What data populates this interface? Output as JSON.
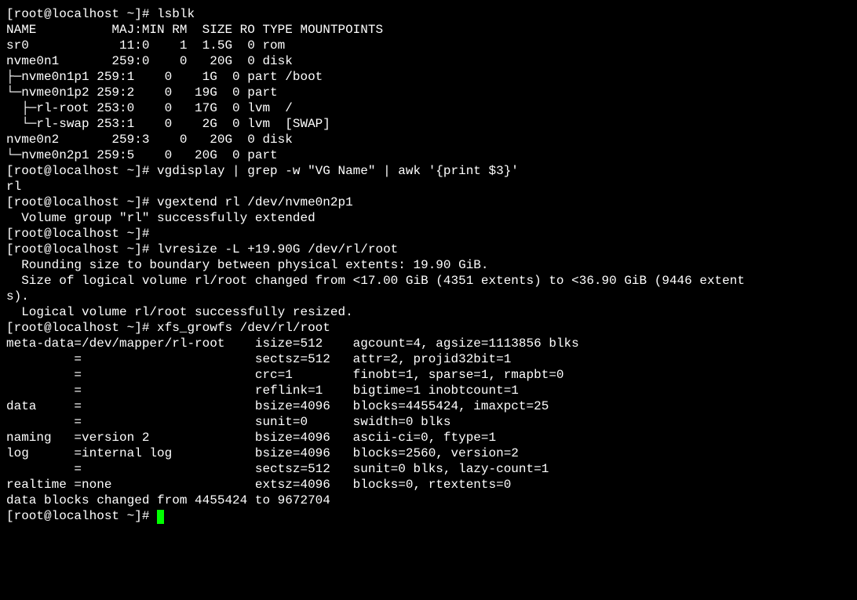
{
  "prompt": "[root@localhost ~]# ",
  "cmd1": "lsblk",
  "lsblk_header": "NAME          MAJ:MIN RM  SIZE RO TYPE MOUNTPOINTS",
  "lsblk_rows": [
    "sr0            11:0    1  1.5G  0 rom",
    "nvme0n1       259:0    0   20G  0 disk",
    "├─nvme0n1p1 259:1    0    1G  0 part /boot",
    "└─nvme0n1p2 259:2    0   19G  0 part",
    "  ├─rl-root 253:0    0   17G  0 lvm  /",
    "  └─rl-swap 253:1    0    2G  0 lvm  [SWAP]",
    "nvme0n2       259:3    0   20G  0 disk",
    "└─nvme0n2p1 259:5    0   20G  0 part"
  ],
  "cmd2": "vgdisplay | grep -w \"VG Name\" | awk '{print $3}'",
  "out2": "rl",
  "cmd3": "vgextend rl /dev/nvme0n2p1",
  "out3": "  Volume group \"rl\" successfully extended",
  "cmd4": "",
  "cmd5": "lvresize -L +19.90G /dev/rl/root",
  "out5a": "  Rounding size to boundary between physical extents: 19.90 GiB.",
  "out5b": "  Size of logical volume rl/root changed from <17.00 GiB (4351 extents) to <36.90 GiB (9446 extent",
  "out5c": "s).",
  "out5d": "  Logical volume rl/root successfully resized.",
  "cmd6": "xfs_growfs /dev/rl/root",
  "xfs_rows": [
    "meta-data=/dev/mapper/rl-root    isize=512    agcount=4, agsize=1113856 blks",
    "         =                       sectsz=512   attr=2, projid32bit=1",
    "         =                       crc=1        finobt=1, sparse=1, rmapbt=0",
    "         =                       reflink=1    bigtime=1 inobtcount=1",
    "data     =                       bsize=4096   blocks=4455424, imaxpct=25",
    "         =                       sunit=0      swidth=0 blks",
    "naming   =version 2              bsize=4096   ascii-ci=0, ftype=1",
    "log      =internal log           bsize=4096   blocks=2560, version=2",
    "         =                       sectsz=512   sunit=0 blks, lazy-count=1",
    "realtime =none                   extsz=4096   blocks=0, rtextents=0",
    "data blocks changed from 4455424 to 9672704"
  ]
}
